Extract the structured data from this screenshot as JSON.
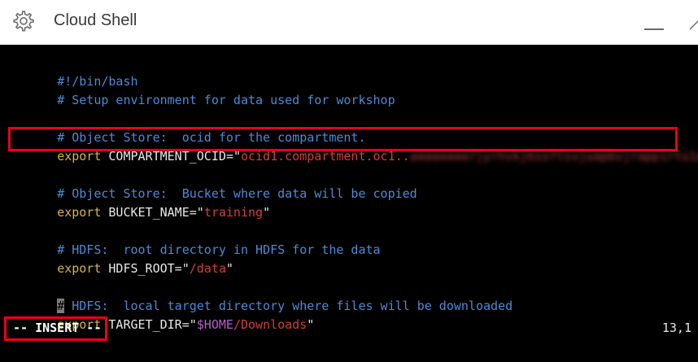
{
  "titlebar": {
    "title": "Cloud Shell",
    "settings_icon": "gear-icon",
    "minimize_icon": "minimize-icon",
    "restore_icon": "restore-icon"
  },
  "editor": {
    "lines": [
      {
        "id": "l1",
        "comment": "#!/bin/bash"
      },
      {
        "id": "l2",
        "comment": "# Setup environment for data used for workshop"
      },
      {
        "id": "l3",
        "comment": "# Object Store:  ocid for the compartment."
      },
      {
        "id": "l4",
        "keyword": "export",
        "variable": " COMPARTMENT_OCID=",
        "q1": "\"",
        "value": "ocid1.compartment.oc1..",
        "redacted": "aaaaaaaa7jyrhvkj6ssftsvjuapbvjrapp1rtu1a",
        "q2": "\""
      },
      {
        "id": "l5",
        "comment": "# Object Store:  Bucket where data will be copied"
      },
      {
        "id": "l6",
        "keyword": "export",
        "variable": " BUCKET_NAME=",
        "q1": "\"",
        "value": "training",
        "q2": "\""
      },
      {
        "id": "l7",
        "comment": "# HDFS:  root directory in HDFS for the data"
      },
      {
        "id": "l8",
        "keyword": "export",
        "variable": " HDFS_ROOT=",
        "q1": "\"",
        "value": "/data",
        "q2": "\""
      },
      {
        "id": "l9",
        "cursor_char": "#",
        "comment": " HDFS:  local target directory where files will be downloaded"
      },
      {
        "id": "l10",
        "keyword": "export",
        "variable": " TARGET_DIR=",
        "q1": "\"",
        "dollar": "$HOME",
        "value": "/Downloads",
        "q2": "\""
      }
    ],
    "mode": "-- INSERT --",
    "cursor_position": "13,1"
  },
  "colors": {
    "comment": "#4a8bd6",
    "keyword": "#d7b24a",
    "string": "#d43c3c",
    "highlight_box": "#e8001c"
  }
}
